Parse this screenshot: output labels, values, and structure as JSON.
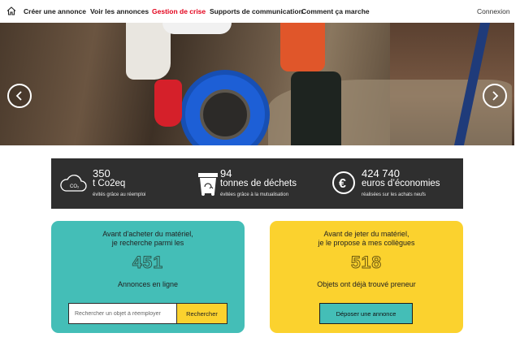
{
  "nav": {
    "items": [
      {
        "label": "Créer une annonce"
      },
      {
        "label": "Voir les annonces"
      },
      {
        "label": "Gestion de crise",
        "active": true
      },
      {
        "label": "Supports de communication"
      },
      {
        "label": "Comment ça marche"
      }
    ],
    "login": "Connexion",
    "active_color": "#e3001b"
  },
  "hero": {
    "prev_icon": "chevron-left-icon",
    "next_icon": "chevron-right-icon"
  },
  "stats": {
    "co2": {
      "value": "350",
      "unit": "t Co2eq",
      "sub": "évités grâce au réemploi",
      "icon": "co2-cloud-icon",
      "icon_text": "CO₂"
    },
    "waste": {
      "value": "94",
      "unit": "tonnes de déchets",
      "sub": "évitées grâce à la mutualisation",
      "icon": "recycling-bin-icon"
    },
    "savings": {
      "value": "424 740",
      "unit": "euros d’économies",
      "sub": "réalisées sur les achats neufs",
      "icon": "euro-icon",
      "icon_text": "€"
    }
  },
  "buy_card": {
    "lead_line1": "Avant d'acheter du matériel,",
    "lead_line2": "je recherche parmi les",
    "count": "451",
    "caption": "Annonces en ligne",
    "search_placeholder": "Rechercher un objet à réemployer",
    "search_button": "Rechercher",
    "color": "#44beb7"
  },
  "give_card": {
    "lead_line1": "Avant de jeter du matériel,",
    "lead_line2": "je le propose à mes collègues",
    "count": "518",
    "caption": "Objets ont déjà trouvé preneur",
    "button": "Déposer une annonce",
    "color": "#fbd22e"
  }
}
